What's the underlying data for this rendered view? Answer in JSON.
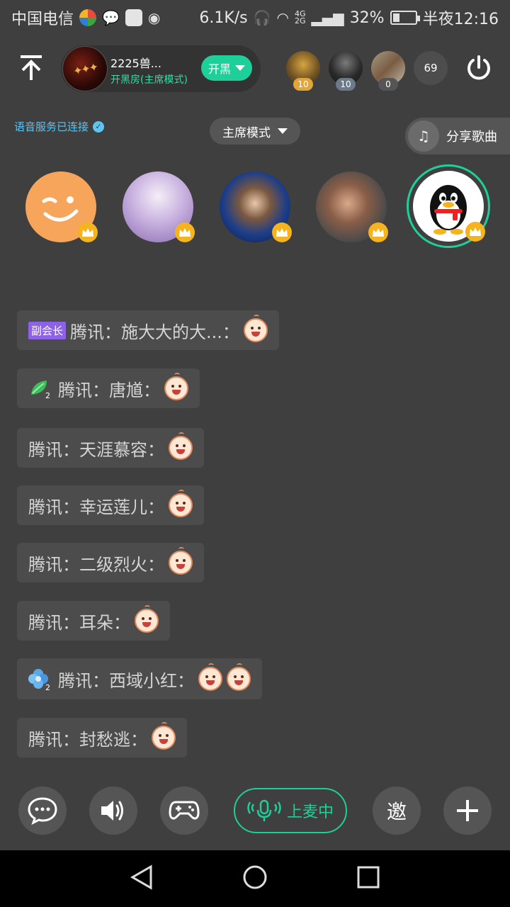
{
  "status_bar": {
    "carrier": "中国电信",
    "speed": "6.1K/s",
    "battery": "32%",
    "battery_level": 0.32,
    "time": "半夜12:16"
  },
  "header": {
    "room_name": "2225兽...",
    "room_subtitle": "开黑房(主席模式)",
    "kaihei_label": "开黑",
    "viewers": [
      {
        "badge": "10",
        "color": "#c08a3a"
      },
      {
        "badge": "10",
        "color": "#2a2a2a"
      },
      {
        "badge": "0",
        "color": "#8a6a4a"
      }
    ],
    "viewer_count": "69"
  },
  "voice_status": "语音服务已连接",
  "mode_label": "主席模式",
  "share_label": "分享歌曲",
  "messages": [
    {
      "tag": "副会长",
      "text": "腾讯：施大大的大...：",
      "emoji_count": 1
    },
    {
      "text": "腾讯：唐馗：",
      "emoji_count": 1,
      "badge": "leaf"
    },
    {
      "text": "腾讯：天涯慕容：",
      "emoji_count": 1
    },
    {
      "text": "腾讯：幸运莲儿：",
      "emoji_count": 1
    },
    {
      "text": "腾讯：二级烈火：",
      "emoji_count": 1
    },
    {
      "text": "腾讯：耳朵：",
      "emoji_count": 1
    },
    {
      "text": "腾讯：西域小红：",
      "emoji_count": 2,
      "badge": "flower"
    },
    {
      "text": "腾讯：封愁逃：",
      "emoji_count": 1
    }
  ],
  "actions": {
    "mic_label": "上麦中",
    "invite_label": "邀"
  },
  "colors": {
    "accent": "#1fcf99",
    "background": "#3f3f3f",
    "bubble": "#4c4c4c",
    "link": "#5fc4ef",
    "crown": "#f5b31d",
    "tag": "#8d61e8"
  }
}
